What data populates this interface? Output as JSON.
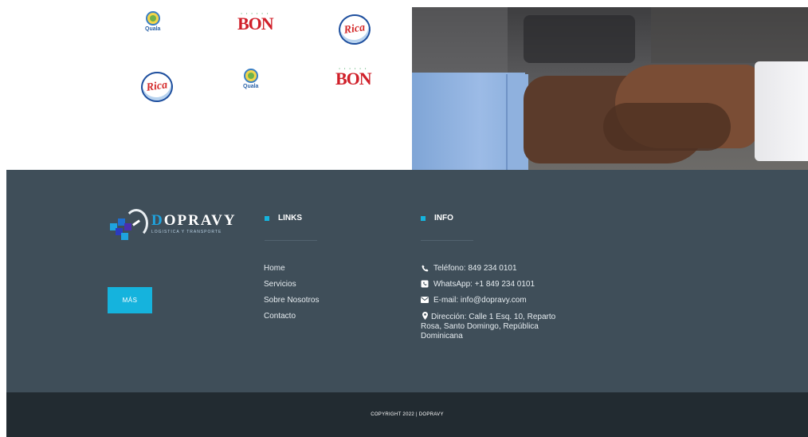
{
  "partner_logos": [
    {
      "kind": "quala",
      "text": "Quala"
    },
    {
      "kind": "bon",
      "text": "BON",
      "dots": "• • • • • •"
    },
    {
      "kind": "rica",
      "text": "Rica"
    },
    {
      "kind": "rica",
      "text": "Rica"
    },
    {
      "kind": "quala",
      "text": "Quala"
    },
    {
      "kind": "bon",
      "text": "BON",
      "dots": "• • • • • •"
    }
  ],
  "brand": {
    "name_first": "D",
    "name_rest": "OPRAVY",
    "tagline": "LOGISTICA Y TRANSPORTE"
  },
  "more_button": {
    "label": "MÁS"
  },
  "links_section": {
    "title": "LINKS",
    "items": [
      "Home",
      "Servicios",
      "Sobre Nosotros",
      "Contacto"
    ]
  },
  "info_section": {
    "title": "INFO",
    "phone": "Teléfono: 849 234 0101",
    "whatsapp": "WhatsApp: +1 849 234 0101",
    "email": "E-mail: info@dopravy.com",
    "address": "Dirección: Calle 1 Esq. 10, Reparto Rosa, Santo Domingo, República Dominicana"
  },
  "copyright": "COPYRIGHT 2022 | DOPRAVY",
  "colors": {
    "footer_bg": "#3f4e59",
    "bottom_bar_bg": "#222b31",
    "accent": "#15b3dd"
  },
  "icons": {
    "phone": "phone-icon",
    "whatsapp": "whatsapp-icon",
    "email": "envelope-icon",
    "address": "map-marker-icon"
  }
}
